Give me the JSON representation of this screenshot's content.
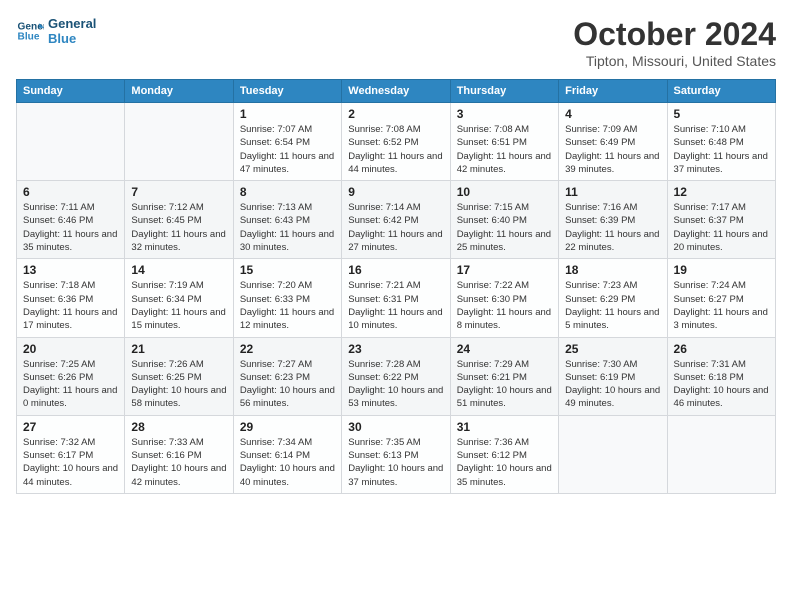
{
  "header": {
    "logo_line1": "General",
    "logo_line2": "Blue",
    "month_title": "October 2024",
    "location": "Tipton, Missouri, United States"
  },
  "days_of_week": [
    "Sunday",
    "Monday",
    "Tuesday",
    "Wednesday",
    "Thursday",
    "Friday",
    "Saturday"
  ],
  "weeks": [
    [
      {
        "day": "",
        "detail": ""
      },
      {
        "day": "",
        "detail": ""
      },
      {
        "day": "1",
        "detail": "Sunrise: 7:07 AM\nSunset: 6:54 PM\nDaylight: 11 hours and 47 minutes."
      },
      {
        "day": "2",
        "detail": "Sunrise: 7:08 AM\nSunset: 6:52 PM\nDaylight: 11 hours and 44 minutes."
      },
      {
        "day": "3",
        "detail": "Sunrise: 7:08 AM\nSunset: 6:51 PM\nDaylight: 11 hours and 42 minutes."
      },
      {
        "day": "4",
        "detail": "Sunrise: 7:09 AM\nSunset: 6:49 PM\nDaylight: 11 hours and 39 minutes."
      },
      {
        "day": "5",
        "detail": "Sunrise: 7:10 AM\nSunset: 6:48 PM\nDaylight: 11 hours and 37 minutes."
      }
    ],
    [
      {
        "day": "6",
        "detail": "Sunrise: 7:11 AM\nSunset: 6:46 PM\nDaylight: 11 hours and 35 minutes."
      },
      {
        "day": "7",
        "detail": "Sunrise: 7:12 AM\nSunset: 6:45 PM\nDaylight: 11 hours and 32 minutes."
      },
      {
        "day": "8",
        "detail": "Sunrise: 7:13 AM\nSunset: 6:43 PM\nDaylight: 11 hours and 30 minutes."
      },
      {
        "day": "9",
        "detail": "Sunrise: 7:14 AM\nSunset: 6:42 PM\nDaylight: 11 hours and 27 minutes."
      },
      {
        "day": "10",
        "detail": "Sunrise: 7:15 AM\nSunset: 6:40 PM\nDaylight: 11 hours and 25 minutes."
      },
      {
        "day": "11",
        "detail": "Sunrise: 7:16 AM\nSunset: 6:39 PM\nDaylight: 11 hours and 22 minutes."
      },
      {
        "day": "12",
        "detail": "Sunrise: 7:17 AM\nSunset: 6:37 PM\nDaylight: 11 hours and 20 minutes."
      }
    ],
    [
      {
        "day": "13",
        "detail": "Sunrise: 7:18 AM\nSunset: 6:36 PM\nDaylight: 11 hours and 17 minutes."
      },
      {
        "day": "14",
        "detail": "Sunrise: 7:19 AM\nSunset: 6:34 PM\nDaylight: 11 hours and 15 minutes."
      },
      {
        "day": "15",
        "detail": "Sunrise: 7:20 AM\nSunset: 6:33 PM\nDaylight: 11 hours and 12 minutes."
      },
      {
        "day": "16",
        "detail": "Sunrise: 7:21 AM\nSunset: 6:31 PM\nDaylight: 11 hours and 10 minutes."
      },
      {
        "day": "17",
        "detail": "Sunrise: 7:22 AM\nSunset: 6:30 PM\nDaylight: 11 hours and 8 minutes."
      },
      {
        "day": "18",
        "detail": "Sunrise: 7:23 AM\nSunset: 6:29 PM\nDaylight: 11 hours and 5 minutes."
      },
      {
        "day": "19",
        "detail": "Sunrise: 7:24 AM\nSunset: 6:27 PM\nDaylight: 11 hours and 3 minutes."
      }
    ],
    [
      {
        "day": "20",
        "detail": "Sunrise: 7:25 AM\nSunset: 6:26 PM\nDaylight: 11 hours and 0 minutes."
      },
      {
        "day": "21",
        "detail": "Sunrise: 7:26 AM\nSunset: 6:25 PM\nDaylight: 10 hours and 58 minutes."
      },
      {
        "day": "22",
        "detail": "Sunrise: 7:27 AM\nSunset: 6:23 PM\nDaylight: 10 hours and 56 minutes."
      },
      {
        "day": "23",
        "detail": "Sunrise: 7:28 AM\nSunset: 6:22 PM\nDaylight: 10 hours and 53 minutes."
      },
      {
        "day": "24",
        "detail": "Sunrise: 7:29 AM\nSunset: 6:21 PM\nDaylight: 10 hours and 51 minutes."
      },
      {
        "day": "25",
        "detail": "Sunrise: 7:30 AM\nSunset: 6:19 PM\nDaylight: 10 hours and 49 minutes."
      },
      {
        "day": "26",
        "detail": "Sunrise: 7:31 AM\nSunset: 6:18 PM\nDaylight: 10 hours and 46 minutes."
      }
    ],
    [
      {
        "day": "27",
        "detail": "Sunrise: 7:32 AM\nSunset: 6:17 PM\nDaylight: 10 hours and 44 minutes."
      },
      {
        "day": "28",
        "detail": "Sunrise: 7:33 AM\nSunset: 6:16 PM\nDaylight: 10 hours and 42 minutes."
      },
      {
        "day": "29",
        "detail": "Sunrise: 7:34 AM\nSunset: 6:14 PM\nDaylight: 10 hours and 40 minutes."
      },
      {
        "day": "30",
        "detail": "Sunrise: 7:35 AM\nSunset: 6:13 PM\nDaylight: 10 hours and 37 minutes."
      },
      {
        "day": "31",
        "detail": "Sunrise: 7:36 AM\nSunset: 6:12 PM\nDaylight: 10 hours and 35 minutes."
      },
      {
        "day": "",
        "detail": ""
      },
      {
        "day": "",
        "detail": ""
      }
    ]
  ]
}
